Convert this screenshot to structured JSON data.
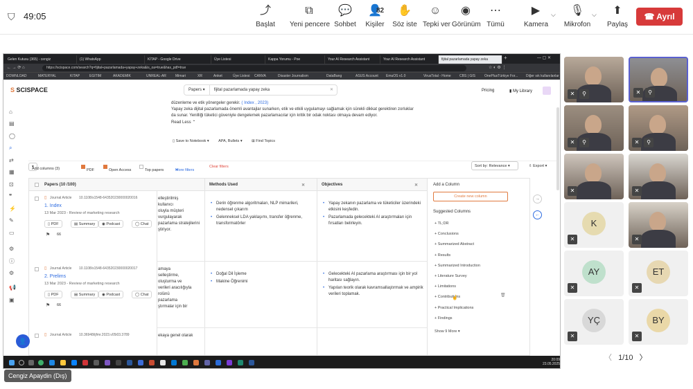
{
  "meeting": {
    "timer": "49:05",
    "toolbar": [
      {
        "label": "Başlat",
        "icon": "screen-share-icon",
        "glyph": "⤴"
      },
      {
        "label": "Yeni pencere",
        "icon": "new-window-icon",
        "glyph": "⧉"
      },
      {
        "label": "Sohbet",
        "icon": "chat-icon",
        "glyph": "💬"
      },
      {
        "label": "Kişiler",
        "icon": "people-icon",
        "glyph": "👤"
      },
      {
        "label": "Söz iste",
        "icon": "raise-hand-icon",
        "glyph": "✋"
      },
      {
        "label": "Tepki ver",
        "icon": "reaction-icon",
        "glyph": "☺"
      },
      {
        "label": "Görünüm",
        "icon": "view-icon",
        "glyph": "◉"
      },
      {
        "label": "Tümü",
        "icon": "more-icon",
        "glyph": "⋯"
      },
      {
        "label": "Kamera",
        "icon": "camera-icon",
        "glyph": "▶"
      },
      {
        "label": "Mikrofon",
        "icon": "mic-off-icon",
        "glyph": "🎙"
      },
      {
        "label": "Paylaş",
        "icon": "share-icon",
        "glyph": "⬆"
      }
    ],
    "people_count": "82",
    "leave_label": "Ayrıl",
    "presenter": "Cengiz Apaydin (Dış)",
    "pager": "1/10",
    "tiles": [
      {
        "initials": "",
        "bg": "#b8a99a"
      },
      {
        "initials": "",
        "bg": "#8e8f93"
      },
      {
        "initials": "",
        "bg": "#9c8e80"
      },
      {
        "initials": "",
        "bg": "#b09a86"
      },
      {
        "initials": "",
        "bg": "#cfc6bd"
      },
      {
        "initials": "",
        "bg": "#d9d6d0"
      },
      {
        "initials": "K",
        "bg": "#e6dbb0"
      },
      {
        "initials": "",
        "bg": "#d8d2c8"
      },
      {
        "initials": "AY",
        "bg": "#bfe0cc"
      },
      {
        "initials": "ET",
        "bg": "#e7d8b2"
      },
      {
        "initials": "YÇ",
        "bg": "#d8d8d8"
      },
      {
        "initials": "BY",
        "bg": "#ead8a8"
      }
    ]
  },
  "browser": {
    "tabs": [
      "Gelen Kutusu (365) - cengiz",
      "(1) WhatsApp",
      "KİTAP - Google Drive",
      "Üye Listesi",
      "Kappa Yorumu - Poe",
      "Your AI Research Assistant",
      "Your AI Research Assistant",
      "fijital pazarlamada yapay zeka"
    ],
    "url": "https://scispace.com/search?q=fijital+pazarlamada+yapay+zeka&is_oa=true&has_pdf=true",
    "bookmarks": [
      "DOWNLOAD",
      "MATERYAL",
      "KITAP",
      "EGITIM",
      "AKADEMIK",
      "UNREAL-AR",
      "Mimari",
      "XR",
      "Anket",
      "Üye Listesi",
      "CANVA",
      "Disaster Journalism",
      "DataBang",
      "ASUS Account",
      "EmuOS v1.0",
      "VirusTotal - Home",
      "CBS | GIS",
      "OnePlusTürkiye For...",
      "Diğer sık kullanılanlar"
    ]
  },
  "app": {
    "logo_prefix": "S",
    "logo": "SCISPACE",
    "search_type": "Papers",
    "search_query": "fijital pazarlamada yapay zeka",
    "pricing": "Pricing",
    "my_library": "My Library",
    "summary_line0": "düzenleme ve etik yönergeler gerekir.",
    "summary_cite": "( Index , 2023)",
    "summary_text": "Yapay zeka dijital pazarlamada önemli avantajlar sunarken, etik ve etkili uygulamayı sağlamak için sürekli dikkat gerektiren zorluklar da sunar. Yenilliği tüketici güveniyle dengelemek pazarlamacılar için kritik bir odak noktası olmaya devam ediyor.",
    "read_less": "Read Less",
    "save_notebook": "Save to Notebook",
    "apa_bullets": "APA, Bullets",
    "find_topics": "Find Topics",
    "add_columns": "Add columns (3)",
    "pdf_filter": "PDF",
    "open_access": "Open Access",
    "top_papers": "Top papers",
    "more_filters": "More filters",
    "clear_filters": "Clear filters",
    "sort_by": "Sort by: Relevance",
    "export": "Export",
    "col_papers": "Papers (10 /100)",
    "col_methods": "Methods Used",
    "col_objectives": "Objectives",
    "rows": [
      {
        "type": "Journal Article",
        "doi": "10.1108/s1548-643520230000020016",
        "title": "1. Index",
        "date": "13 Mar 2023 - Review of marketing research",
        "count": "66",
        "behind": [
          "elleştirilmiş",
          "kullanıcı",
          "oluyla müşteri",
          "vurgulayarak",
          "pazarlama stratejilerini",
          "ştiriyor."
        ],
        "methods": [
          "Derin öğrenme algoritmaları, NLP mimarileri, nedensel çıkarım",
          "Gelenneksel LDA yaklaşımı, transfer öğrenme, transformatörler"
        ],
        "objectives": [
          "Yapay zekanın pazarlama ve tüketiciler üzerindeki etkisini keşfedin.",
          "Pazarlamada gelecekteki AI araştırmaları için fırsatları belirleyin."
        ]
      },
      {
        "type": "Journal Article",
        "doi": "10.1108/s1548-643520230000020017",
        "title": "2. Prelims",
        "date": "13 Mar 2023 - Review of marketing research",
        "count": "66",
        "behind": [
          "amaya",
          "selleştirme,",
          "oluşturma ve",
          "verileri aracılığıyla",
          "rolünü",
          "pazarlama",
          "ştırmalar için bir"
        ],
        "methods": [
          "Doğal Dil İşleme",
          "Makine Öğrenimi"
        ],
        "objectives": [
          "Gelecekteki AI pazarlama araştırması için bir yol haritası sağlayın.",
          "Yapılan teorik olarak kavramsallaştırmak ve ampirik verileri toplamak."
        ]
      },
      {
        "type": "Journal Article",
        "doi": "10.36948/ijfmr.2023.v05i03.3789",
        "title": "",
        "date": "",
        "count": "",
        "behind": [
          "ekaya genel olarak"
        ],
        "methods": [],
        "objectives": []
      }
    ],
    "btn_pdf": "PDF",
    "btn_summary": "Summary",
    "btn_podcast": "Podcast",
    "btn_chat": "Chat",
    "add_column": "Add a Column",
    "create_new_column": "Create new column",
    "suggested_columns": "Suggested Columns",
    "suggested": [
      "TL;DR",
      "Conclusions",
      "Summarized Abstract",
      "Results",
      "Summarized Introduction",
      "Literature Survey",
      "Limitations",
      "Contributions",
      "Practical Implications",
      "Findings"
    ],
    "show_more": "Show 9 More"
  },
  "taskbar": {
    "time": "20:09",
    "date": "23.05.2025"
  },
  "colors": {
    "accent": "#e0793e",
    "link": "#2d6be0",
    "leave": "#d73a3a"
  }
}
